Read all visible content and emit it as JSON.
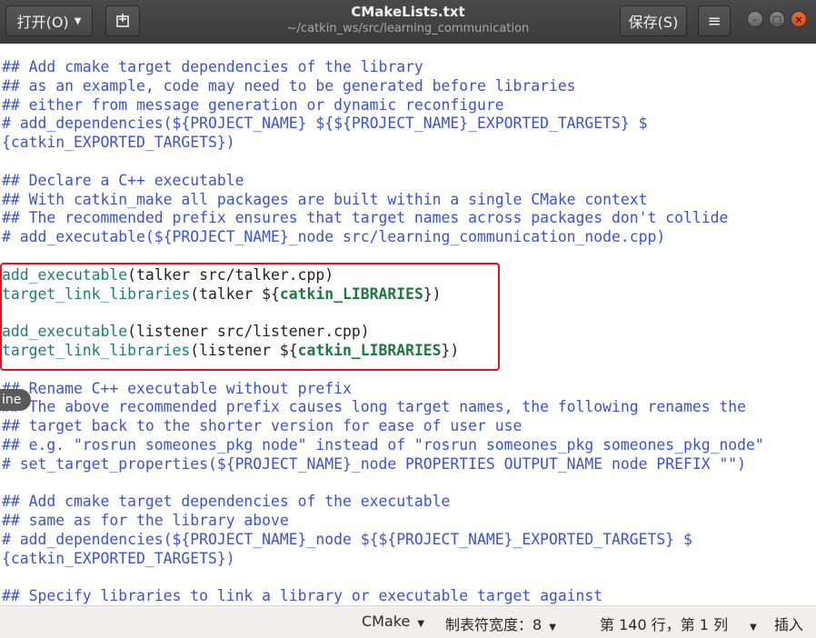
{
  "header": {
    "open_label": "打开(O)",
    "save_label": "保存(S)",
    "title": "CMakeLists.txt",
    "subtitle": "~/catkin_ws/src/learning_communication"
  },
  "editor": {
    "lines": [
      "## Add cmake target dependencies of the library",
      "## as an example, code may need to be generated before libraries",
      "## either from message generation or dynamic reconfigure",
      "# add_dependencies(${PROJECT_NAME} ${${PROJECT_NAME}_EXPORTED_TARGETS} $",
      "{catkin_EXPORTED_TARGETS})",
      "",
      "## Declare a C++ executable",
      "## With catkin_make all packages are built within a single CMake context",
      "## The recommended prefix ensures that target names across packages don't collide",
      "# add_executable(${PROJECT_NAME}_node src/learning_communication_node.cpp)",
      "",
      [
        "add_executable",
        "(talker src/talker.cpp)"
      ],
      [
        "target_link_libraries",
        "(talker ${",
        "catkin_LIBRARIES",
        "})"
      ],
      "",
      [
        "add_executable",
        "(listener src/listener.cpp)"
      ],
      [
        "target_link_libraries",
        "(listener ${",
        "catkin_LIBRARIES",
        "})"
      ],
      "",
      "## Rename C++ executable without prefix",
      "## The above recommended prefix causes long target names, the following renames the",
      "## target back to the shorter version for ease of user use",
      "## e.g. \"rosrun someones_pkg node\" instead of \"rosrun someones_pkg someones_pkg_node\"",
      "# set_target_properties(${PROJECT_NAME}_node PROPERTIES OUTPUT_NAME node PREFIX \"\")",
      "",
      "## Add cmake target dependencies of the executable",
      "## same as for the library above",
      "# add_dependencies(${PROJECT_NAME}_node ${${PROJECT_NAME}_EXPORTED_TARGETS} $",
      "{catkin_EXPORTED_TARGETS})",
      "",
      "## Specify libraries to link a library or executable target against"
    ],
    "overlay_tag": "ine"
  },
  "statusbar": {
    "language": "CMake",
    "tab_width": "制表符宽度：8",
    "cursor_position": "第 140 行，第 1 列",
    "insert_mode": "插入"
  },
  "icons": {
    "new_document": "new-document-icon",
    "menu": "hamburger-menu-icon",
    "minimize": "minimize-icon",
    "maximize": "maximize-icon",
    "close": "close-icon"
  },
  "colors": {
    "header_bg": "#3b3b3b",
    "comment": "#3a54d0",
    "command": "#1b7d7a",
    "variable": "#1d7a3e",
    "highlight_box": "#e2151b",
    "close_button": "#e0531e"
  }
}
